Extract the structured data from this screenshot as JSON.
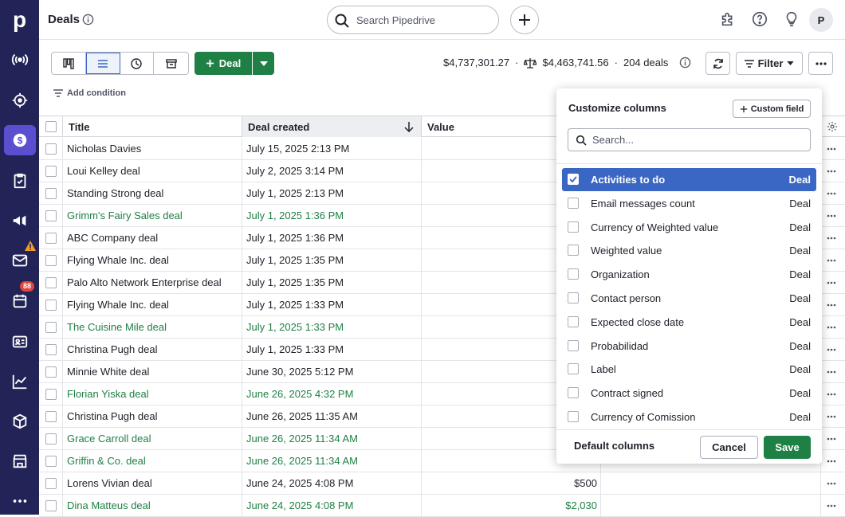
{
  "app": {
    "logo_letter": "p",
    "notification_count": "88"
  },
  "header": {
    "title": "Deals",
    "search_placeholder": "Search Pipedrive",
    "avatar_initial": "P"
  },
  "toolbar": {
    "deal_button": "Deal",
    "total_value": "$4,737,301.27",
    "weighted_value": "$4,463,741.56",
    "deal_count": "204 deals",
    "separator": "·",
    "filter_label": "Filter",
    "add_condition": "Add condition"
  },
  "table": {
    "columns": {
      "title": "Title",
      "deal_created": "Deal created",
      "value": "Value"
    },
    "rows": [
      {
        "title": "Nicholas Davies",
        "created": "July 15, 2025 2:13 PM",
        "value": "",
        "green": false
      },
      {
        "title": "Loui Kelley deal",
        "created": "July 2, 2025 3:14 PM",
        "value": "",
        "green": false
      },
      {
        "title": "Standing Strong deal",
        "created": "July 1, 2025 2:13 PM",
        "value": "",
        "green": false
      },
      {
        "title": "Grimm's Fairy Sales deal",
        "created": "July 1, 2025 1:36 PM",
        "value": "",
        "green": true
      },
      {
        "title": "ABC Company deal",
        "created": "July 1, 2025 1:36 PM",
        "value": "",
        "green": false
      },
      {
        "title": "Flying Whale Inc. deal",
        "created": "July 1, 2025 1:35 PM",
        "value": "",
        "green": false
      },
      {
        "title": "Palo Alto Network Enterprise deal",
        "created": "July 1, 2025 1:35 PM",
        "value": "",
        "green": false
      },
      {
        "title": "Flying Whale Inc. deal",
        "created": "July 1, 2025 1:33 PM",
        "value": "",
        "green": false
      },
      {
        "title": "The Cuisine Mile deal",
        "created": "July 1, 2025 1:33 PM",
        "value": "",
        "green": true
      },
      {
        "title": "Christina Pugh deal",
        "created": "July 1, 2025 1:33 PM",
        "value": "",
        "green": false
      },
      {
        "title": "Minnie White deal",
        "created": "June 30, 2025 5:12 PM",
        "value": "",
        "green": false
      },
      {
        "title": "Florian Yiska deal",
        "created": "June 26, 2025 4:32 PM",
        "value": "",
        "green": true
      },
      {
        "title": "Christina Pugh deal",
        "created": "June 26, 2025 11:35 AM",
        "value": "",
        "green": false
      },
      {
        "title": "Grace Carroll deal",
        "created": "June 26, 2025 11:34 AM",
        "value": "",
        "green": true
      },
      {
        "title": "Griffin & Co. deal",
        "created": "June 26, 2025 11:34 AM",
        "value": "",
        "green": true
      },
      {
        "title": "Lorens Vivian deal",
        "created": "June 24, 2025 4:08 PM",
        "value": "$500",
        "green": false
      },
      {
        "title": "Dina Matteus deal",
        "created": "June 24, 2025 4:08 PM",
        "value": "$2,030",
        "green": true
      }
    ]
  },
  "customize": {
    "title": "Customize columns",
    "custom_field": "Custom field",
    "search_placeholder": "Search...",
    "options": [
      {
        "label": "Activities to do",
        "group": "Deal",
        "checked": true
      },
      {
        "label": "Email messages count",
        "group": "Deal",
        "checked": false
      },
      {
        "label": "Currency of Weighted value",
        "group": "Deal",
        "checked": false
      },
      {
        "label": "Weighted value",
        "group": "Deal",
        "checked": false
      },
      {
        "label": "Organization",
        "group": "Deal",
        "checked": false
      },
      {
        "label": "Contact person",
        "group": "Deal",
        "checked": false
      },
      {
        "label": "Expected close date",
        "group": "Deal",
        "checked": false
      },
      {
        "label": "Probabilidad",
        "group": "Deal",
        "checked": false
      },
      {
        "label": "Label",
        "group": "Deal",
        "checked": false
      },
      {
        "label": "Contract signed",
        "group": "Deal",
        "checked": false
      },
      {
        "label": "Currency of Comission",
        "group": "Deal",
        "checked": false
      }
    ],
    "default_columns": "Default columns",
    "cancel": "Cancel",
    "save": "Save"
  },
  "colors": {
    "sidebar": "#222357",
    "accent": "#5a4fcf",
    "green": "#1f8045",
    "blue": "#3a66c4",
    "badge": "#e2453c"
  }
}
